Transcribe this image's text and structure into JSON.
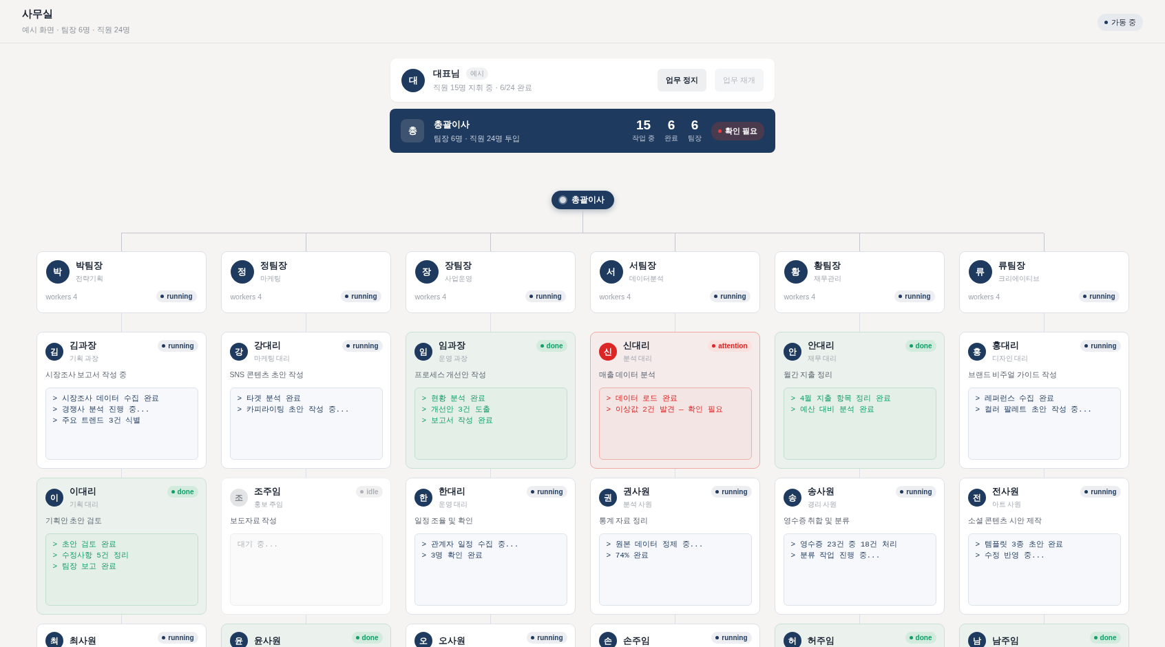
{
  "header": {
    "title": "사무실",
    "subtitle": "예시 화면 · 팀장 6명 · 직원 24명",
    "status": "가동 중"
  },
  "ceo": {
    "avatar": "대",
    "name": "대표님",
    "tag": "예시",
    "subtitle": "직원 15명 지휘 중 · 6/24 완료",
    "buttons": [
      {
        "label": "업무 정지",
        "disabled": false
      },
      {
        "label": "업무 재개",
        "disabled": true
      }
    ]
  },
  "director": {
    "avatar": "총",
    "name": "총괄이사",
    "subtitle": "팀장 6명 · 직원 24명 투입",
    "stats": [
      {
        "value": "15",
        "label": "작업 중"
      },
      {
        "value": "6",
        "label": "완료"
      },
      {
        "value": "6",
        "label": "팀장"
      }
    ],
    "alert": "확인 필요"
  },
  "root_node": "총괄이사",
  "teams": [
    {
      "leader": {
        "avatar": "박",
        "name": "박팀장",
        "dept": "전략기획",
        "workers": "workers 4",
        "status": "running"
      },
      "members": [
        {
          "avatar": "김",
          "name": "김과장",
          "role": "기획 과장",
          "status": "running",
          "task": "시장조사 보고서 작성 중",
          "logs": [
            "> 시장조사 데이터 수집 완료",
            "> 경쟁사 분석 진행 중...",
            "> 주요 트렌드 3건 식별"
          ]
        },
        {
          "avatar": "이",
          "name": "이대리",
          "role": "기획 대리",
          "status": "done",
          "task": "기획안 초안 검토",
          "logs": [
            "> 초안 검토 완료",
            "> 수정사항 5건 정리",
            "> 팀장 보고 완료"
          ]
        },
        {
          "avatar": "최",
          "name": "최사원",
          "status": "running"
        }
      ]
    },
    {
      "leader": {
        "avatar": "정",
        "name": "정팀장",
        "dept": "마케팅",
        "workers": "workers 4",
        "status": "running"
      },
      "members": [
        {
          "avatar": "강",
          "name": "강대리",
          "role": "마케팅 대리",
          "status": "running",
          "task": "SNS 콘텐츠 초안 작성",
          "logs": [
            "> 타겟 분석 완료",
            "> 카피라이팅 초안 작성 중..."
          ]
        },
        {
          "avatar": "조",
          "name": "조주임",
          "role": "홍보 주임",
          "status": "idle",
          "task": "보도자료 작성",
          "logs": [
            "대기 중..."
          ]
        },
        {
          "avatar": "윤",
          "name": "윤사원",
          "status": "done"
        }
      ]
    },
    {
      "leader": {
        "avatar": "장",
        "name": "장팀장",
        "dept": "사업운영",
        "workers": "workers 4",
        "status": "running"
      },
      "members": [
        {
          "avatar": "임",
          "name": "임과장",
          "role": "운영 과장",
          "status": "done",
          "task": "프로세스 개선안 작성",
          "logs": [
            "> 현황 분석 완료",
            "> 개선안 3건 도출",
            "> 보고서 작성 완료"
          ]
        },
        {
          "avatar": "한",
          "name": "한대리",
          "role": "운영 대리",
          "status": "running",
          "task": "일정 조율 및 확인",
          "logs": [
            "> 관계자 일정 수집 중...",
            "> 3명 확인 완료"
          ]
        },
        {
          "avatar": "오",
          "name": "오사원",
          "status": "running"
        }
      ]
    },
    {
      "leader": {
        "avatar": "서",
        "name": "서팀장",
        "dept": "데이터분석",
        "workers": "workers 4",
        "status": "running"
      },
      "members": [
        {
          "avatar": "신",
          "name": "신대리",
          "role": "분석 대리",
          "status": "attention",
          "task": "매출 데이터 분석",
          "logs": [
            "> 데이터 로드 완료",
            "> 이상값 2건 발견 — 확인 필요"
          ]
        },
        {
          "avatar": "권",
          "name": "권사원",
          "role": "분석 사원",
          "status": "running",
          "task": "통계 자료 정리",
          "logs": [
            "> 원본 데이터 정제 중...",
            "> 74% 완료"
          ]
        },
        {
          "avatar": "손",
          "name": "손주임",
          "status": "running"
        }
      ]
    },
    {
      "leader": {
        "avatar": "황",
        "name": "황팀장",
        "dept": "재무관리",
        "workers": "workers 4",
        "status": "running"
      },
      "members": [
        {
          "avatar": "안",
          "name": "안대리",
          "role": "재무 대리",
          "status": "done",
          "task": "월간 지출 정리",
          "logs": [
            "> 4월 지출 항목 정리 완료",
            "> 예산 대비 분석 완료"
          ]
        },
        {
          "avatar": "송",
          "name": "송사원",
          "role": "경리 사원",
          "status": "running",
          "task": "영수증 취합 및 분류",
          "logs": [
            "> 영수증 23건 중 18건 처리",
            "> 분류 작업 진행 중..."
          ]
        },
        {
          "avatar": "허",
          "name": "허주임",
          "status": "done"
        }
      ]
    },
    {
      "leader": {
        "avatar": "류",
        "name": "류팀장",
        "dept": "크리에이티브",
        "workers": "workers 4",
        "status": "running"
      },
      "members": [
        {
          "avatar": "홍",
          "name": "홍대리",
          "role": "디자인 대리",
          "status": "running",
          "task": "브랜드 비주얼 가이드 작성",
          "logs": [
            "> 레퍼런스 수집 완료",
            "> 컬러 팔레트 초안 작성 중..."
          ]
        },
        {
          "avatar": "전",
          "name": "전사원",
          "role": "아트 사원",
          "status": "running",
          "task": "소셜 콘텐츠 시안 제작",
          "logs": [
            "> 템플릿 3종 초안 완료",
            "> 수정 반영 중..."
          ]
        },
        {
          "avatar": "남",
          "name": "남주임",
          "status": "done"
        }
      ]
    }
  ]
}
